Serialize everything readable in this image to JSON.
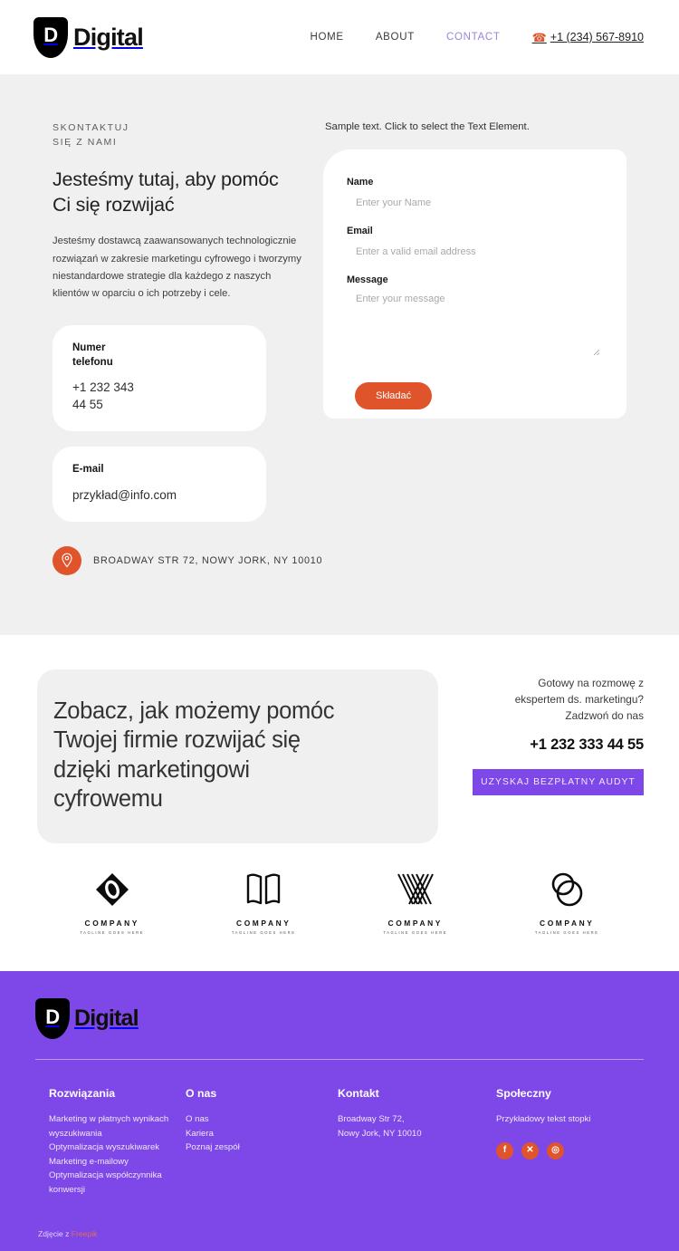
{
  "header": {
    "logo": {
      "shield_letter": "D",
      "text": "Digital"
    },
    "nav": [
      {
        "label": "HOME",
        "active": false
      },
      {
        "label": "ABOUT",
        "active": false
      },
      {
        "label": "CONTACT",
        "active": true
      }
    ],
    "phone": "+1 (234) 567-8910",
    "phone_icon": "phone-icon"
  },
  "contact": {
    "eyebrow": "SKONTAKTUJ\nSIĘ Z NAMI",
    "heading": "Jesteśmy tutaj, aby pomóc\nCi się rozwijać",
    "body": "Jesteśmy dostawcą zaawansowanych technologicznie rozwiązań w zakresie marketingu cyfrowego i tworzymy niestandardowe strategie dla każdego z naszych klientów w oparciu o ich potrzeby i cele.",
    "phone_card": {
      "label": "Numer\ntelefonu",
      "value": "+1 232 343\n44 55"
    },
    "email_card": {
      "label": "E-mail",
      "value": "przykład@info.com"
    },
    "address": "BROADWAY STR 72, NOWY JORK, NY 10010",
    "address_icon": "location-pin-icon"
  },
  "form": {
    "sample_text": "Sample text. Click to select the Text Element.",
    "name": {
      "label": "Name",
      "placeholder": "Enter your Name",
      "value": ""
    },
    "email": {
      "label": "Email",
      "placeholder": "Enter a valid email address",
      "value": ""
    },
    "message": {
      "label": "Message",
      "placeholder": "Enter your message",
      "value": ""
    },
    "submit_label": "Składać"
  },
  "cta": {
    "title": "Zobacz, jak możemy pomóc\nTwojej firmie rozwijać się\ndzięki marketingowi\ncyfrowemu",
    "subtitle": "Gotowy na rozmowę z\nekspertem ds. marketingu?\nZadzwoń do nas",
    "phone": "+1 232 333 44 55",
    "button_label": "UZYSKAJ BEZPŁATNY AUDYT"
  },
  "clients": [
    {
      "mark": "ring-diamond-icon",
      "name": "COMPANY",
      "tagline": "TAGLINE GOES HERE"
    },
    {
      "mark": "open-book-icon",
      "name": "COMPANY",
      "tagline": "TAGLINE GOES HERE"
    },
    {
      "mark": "chevron-stripes-icon",
      "name": "COMPANY",
      "tagline": "TAGLINE GOES HERE"
    },
    {
      "mark": "double-circle-icon",
      "name": "COMPANY",
      "tagline": "TAGLINE GOES HERE"
    }
  ],
  "footer": {
    "logo": {
      "shield_letter": "D",
      "text": "Digital"
    },
    "columns": [
      {
        "heading": "Rozwiązania",
        "links": [
          "Marketing w płatnych wynikach wyszukiwania",
          "Optymalizacja wyszukiwarek",
          "Marketing e-mailowy",
          "Optymalizacja współczynnika konwersji"
        ]
      },
      {
        "heading": "O nas",
        "links": [
          "O nas",
          "Kariera",
          "Poznaj zespół"
        ]
      },
      {
        "heading": "Kontakt",
        "address": "Broadway Str 72,\nNowy Jork, NY 10010"
      },
      {
        "heading": "Społeczny",
        "note": "Przykładowy tekst stopki",
        "socials": [
          {
            "icon": "facebook-icon",
            "glyph": "f"
          },
          {
            "icon": "x-twitter-icon",
            "glyph": "✕"
          },
          {
            "icon": "instagram-icon",
            "glyph": "◎"
          }
        ]
      }
    ],
    "credit_prefix": "Zdjęcie z ",
    "credit_link": "Freepik"
  },
  "colors": {
    "accent_orange": "#e0542c",
    "purple": "#7e47e8",
    "light_gray": "#f0f0f0",
    "nav_active": "#9a86d6"
  }
}
